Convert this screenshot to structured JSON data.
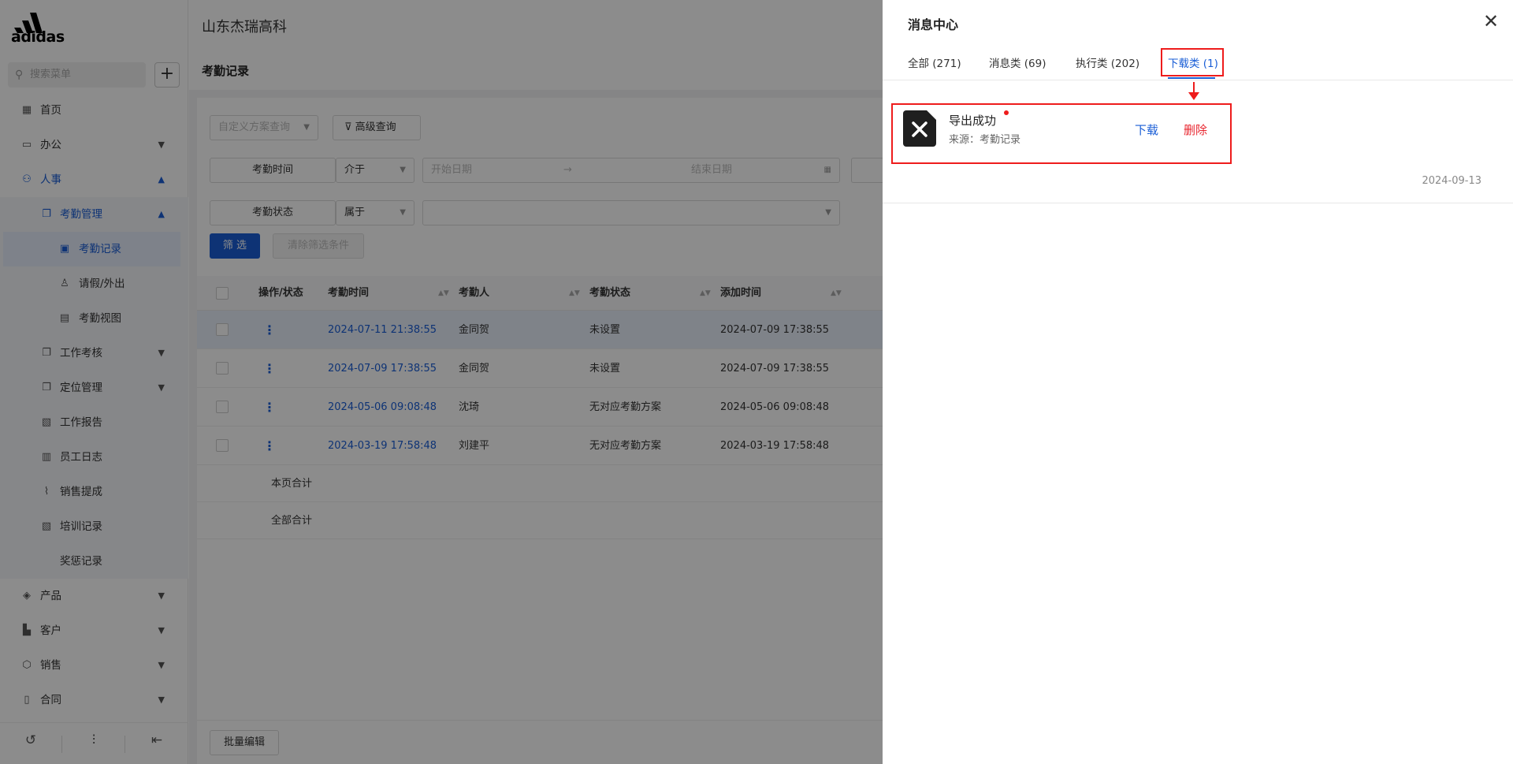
{
  "brand": {
    "logo_text": "adidas",
    "company": "山东杰瑞高科"
  },
  "sidebar": {
    "search_placeholder": "搜索菜单",
    "add_label": "+",
    "items": [
      {
        "icon": "home-icon",
        "label": "首页"
      },
      {
        "icon": "office-icon",
        "label": "办公"
      },
      {
        "icon": "people-icon",
        "label": "人事"
      },
      {
        "icon": "copy-icon",
        "label": "考勤管理"
      },
      {
        "icon": "calendar-icon",
        "label": "考勤记录"
      },
      {
        "icon": "person-icon",
        "label": "请假/外出"
      },
      {
        "icon": "grid-icon",
        "label": "考勤视图"
      },
      {
        "icon": "copy-icon",
        "label": "工作考核"
      },
      {
        "icon": "copy-icon",
        "label": "定位管理"
      },
      {
        "icon": "report-icon",
        "label": "工作报告"
      },
      {
        "icon": "journal-icon",
        "label": "员工日志"
      },
      {
        "icon": "chart-icon",
        "label": "销售提成"
      },
      {
        "icon": "report-icon",
        "label": "培训记录"
      },
      {
        "icon": "",
        "label": "奖惩记录"
      },
      {
        "icon": "box-icon",
        "label": "产品"
      },
      {
        "icon": "building-icon",
        "label": "客户"
      },
      {
        "icon": "hexagon-icon",
        "label": "销售"
      },
      {
        "icon": "doc-icon",
        "label": "合同"
      }
    ],
    "footer": [
      "history-icon",
      "sliders-icon",
      "collapse-icon"
    ]
  },
  "page": {
    "title": "考勤记录",
    "scheme_placeholder": "自定义方案查询",
    "advanced_query": "高级查询",
    "filter1_label": "考勤时间",
    "filter1_op": "介于",
    "start_date": "开始日期",
    "range_sep": "→",
    "end_date": "结束日期",
    "filter2_label": "考勤状态",
    "filter2_op": "属于",
    "filter_btn": "筛 选",
    "clear_btn": "清除筛选条件",
    "batch_edit": "批量编辑"
  },
  "table": {
    "headers": [
      "操作/状态",
      "考勤时间",
      "考勤人",
      "考勤状态",
      "添加时间"
    ],
    "rows": [
      {
        "time": "2024-07-11 21:38:55",
        "person": "金同贺",
        "status": "未设置",
        "added": "2024-07-09 17:38:55"
      },
      {
        "time": "2024-07-09 17:38:55",
        "person": "金同贺",
        "status": "未设置",
        "added": "2024-07-09 17:38:55"
      },
      {
        "time": "2024-05-06 09:08:48",
        "person": "沈琦",
        "status": "无对应考勤方案",
        "added": "2024-05-06 09:08:48"
      },
      {
        "time": "2024-03-19 17:58:48",
        "person": "刘建平",
        "status": "无对应考勤方案",
        "added": "2024-03-19 17:58:48"
      }
    ],
    "page_total": "本页合计",
    "all_total": "全部合计"
  },
  "drawer": {
    "title": "消息中心",
    "close": "✕",
    "tabs": [
      "全部 (271)",
      "消息类 (69)",
      "执行类 (202)",
      "下载类 (1)"
    ],
    "active_tab": 3,
    "message": {
      "title": "导出成功",
      "source": "来源：考勤记录",
      "download": "下载",
      "delete": "删除",
      "date": "2024-09-13"
    }
  },
  "colors": {
    "accent": "#1a5ed6",
    "danger": "#e8262f",
    "annotation": "#ee1c1c"
  }
}
